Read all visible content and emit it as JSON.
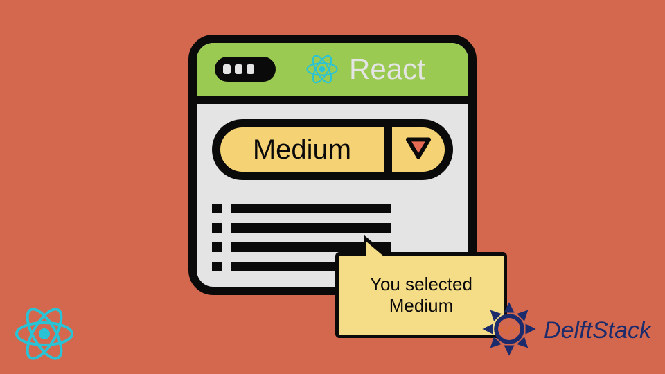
{
  "colors": {
    "background": "#d4684f",
    "window_border": "#0b0a0a",
    "window_body": "#e4e4e4",
    "header_bg": "#9bca53",
    "select_bg": "#f5d274",
    "tooltip_bg": "#f5dc86",
    "react_cyan": "#2ac3d6",
    "delft_text": "#1b2b6b",
    "delft_orange": "#e06a2c",
    "arrow_fill": "#e76a53"
  },
  "header": {
    "title": "React",
    "icon": "react-atom-icon"
  },
  "select": {
    "value": "Medium",
    "arrow_icon": "chevron-down-icon"
  },
  "list": {
    "rows": 4
  },
  "tooltip": {
    "text": "You selected Medium"
  },
  "brand": {
    "name": "DelftStack"
  },
  "corner_icon": "react-atom-icon"
}
